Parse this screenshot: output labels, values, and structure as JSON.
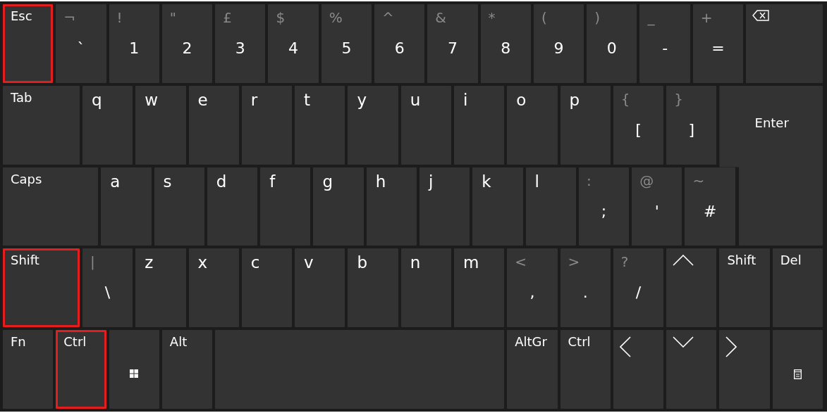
{
  "keyboard": {
    "rows": [
      {
        "keys": [
          {
            "kind": "label",
            "label": "Esc",
            "highlighted": true
          },
          {
            "kind": "symbol",
            "shift": "¬",
            "main": "`",
            "highlighted": false
          },
          {
            "kind": "symbol",
            "shift": "!",
            "main": "1",
            "highlighted": false
          },
          {
            "kind": "symbol",
            "shift": "\"",
            "main": "2",
            "highlighted": false
          },
          {
            "kind": "symbol",
            "shift": "£",
            "main": "3",
            "highlighted": false
          },
          {
            "kind": "symbol",
            "shift": "$",
            "main": "4",
            "highlighted": false
          },
          {
            "kind": "symbol",
            "shift": "%",
            "main": "5",
            "highlighted": false
          },
          {
            "kind": "symbol",
            "shift": "^",
            "main": "6",
            "highlighted": false
          },
          {
            "kind": "symbol",
            "shift": "&",
            "main": "7",
            "highlighted": false
          },
          {
            "kind": "symbol",
            "shift": "*",
            "main": "8",
            "highlighted": false
          },
          {
            "kind": "symbol",
            "shift": "(",
            "main": "9",
            "highlighted": false
          },
          {
            "kind": "symbol",
            "shift": ")",
            "main": "0",
            "highlighted": false
          },
          {
            "kind": "symbol",
            "shift": "_",
            "main": "-",
            "highlighted": false
          },
          {
            "kind": "symbol",
            "shift": "+",
            "main": "=",
            "highlighted": false
          },
          {
            "kind": "backspace",
            "highlighted": false
          }
        ]
      },
      {
        "keys": [
          {
            "kind": "label",
            "label": "Tab",
            "highlighted": false
          },
          {
            "kind": "letter",
            "label": "q",
            "highlighted": false
          },
          {
            "kind": "letter",
            "label": "w",
            "highlighted": false
          },
          {
            "kind": "letter",
            "label": "e",
            "highlighted": false
          },
          {
            "kind": "letter",
            "label": "r",
            "highlighted": false
          },
          {
            "kind": "letter",
            "label": "t",
            "highlighted": false
          },
          {
            "kind": "letter",
            "label": "y",
            "highlighted": false
          },
          {
            "kind": "letter",
            "label": "u",
            "highlighted": false
          },
          {
            "kind": "letter",
            "label": "i",
            "highlighted": false
          },
          {
            "kind": "letter",
            "label": "o",
            "highlighted": false
          },
          {
            "kind": "letter",
            "label": "p",
            "highlighted": false
          },
          {
            "kind": "symbol",
            "shift": "{",
            "main": "[",
            "highlighted": false
          },
          {
            "kind": "symbol",
            "shift": "}",
            "main": "]",
            "highlighted": false
          },
          {
            "kind": "enter",
            "label": "Enter",
            "highlighted": false
          }
        ]
      },
      {
        "keys": [
          {
            "kind": "label",
            "label": "Caps",
            "highlighted": false
          },
          {
            "kind": "letter",
            "label": "a",
            "highlighted": false
          },
          {
            "kind": "letter",
            "label": "s",
            "highlighted": false
          },
          {
            "kind": "letter",
            "label": "d",
            "highlighted": false
          },
          {
            "kind": "letter",
            "label": "f",
            "highlighted": false
          },
          {
            "kind": "letter",
            "label": "g",
            "highlighted": false
          },
          {
            "kind": "letter",
            "label": "h",
            "highlighted": false
          },
          {
            "kind": "letter",
            "label": "j",
            "highlighted": false
          },
          {
            "kind": "letter",
            "label": "k",
            "highlighted": false
          },
          {
            "kind": "letter",
            "label": "l",
            "highlighted": false
          },
          {
            "kind": "symbol",
            "shift": ":",
            "main": ";",
            "highlighted": false
          },
          {
            "kind": "symbol",
            "shift": "@",
            "main": "'",
            "highlighted": false
          },
          {
            "kind": "symbol",
            "shift": "~",
            "main": "#",
            "highlighted": false
          }
        ]
      },
      {
        "keys": [
          {
            "kind": "label",
            "label": "Shift",
            "highlighted": true
          },
          {
            "kind": "symbol",
            "shift": "|",
            "main": "\\",
            "highlighted": false
          },
          {
            "kind": "letter",
            "label": "z",
            "highlighted": false
          },
          {
            "kind": "letter",
            "label": "x",
            "highlighted": false
          },
          {
            "kind": "letter",
            "label": "c",
            "highlighted": false
          },
          {
            "kind": "letter",
            "label": "v",
            "highlighted": false
          },
          {
            "kind": "letter",
            "label": "b",
            "highlighted": false
          },
          {
            "kind": "letter",
            "label": "n",
            "highlighted": false
          },
          {
            "kind": "letter",
            "label": "m",
            "highlighted": false
          },
          {
            "kind": "symbol",
            "shift": "<",
            "main": ",",
            "highlighted": false
          },
          {
            "kind": "symbol",
            "shift": ">",
            "main": ".",
            "highlighted": false
          },
          {
            "kind": "symbol",
            "shift": "?",
            "main": "/",
            "highlighted": false
          },
          {
            "kind": "arrow-up",
            "highlighted": false
          },
          {
            "kind": "label",
            "label": "Shift",
            "highlighted": false
          },
          {
            "kind": "label",
            "label": "Del",
            "highlighted": false
          }
        ]
      },
      {
        "keys": [
          {
            "kind": "label",
            "label": "Fn",
            "highlighted": false
          },
          {
            "kind": "label",
            "label": "Ctrl",
            "highlighted": true
          },
          {
            "kind": "windows",
            "highlighted": false
          },
          {
            "kind": "label",
            "label": "Alt",
            "highlighted": false
          },
          {
            "kind": "space",
            "highlighted": false
          },
          {
            "kind": "label",
            "label": "AltGr",
            "highlighted": false
          },
          {
            "kind": "label",
            "label": "Ctrl",
            "highlighted": false
          },
          {
            "kind": "arrow-left",
            "highlighted": false
          },
          {
            "kind": "arrow-down",
            "highlighted": false
          },
          {
            "kind": "arrow-right",
            "highlighted": false
          },
          {
            "kind": "menu",
            "highlighted": false
          }
        ]
      }
    ]
  }
}
